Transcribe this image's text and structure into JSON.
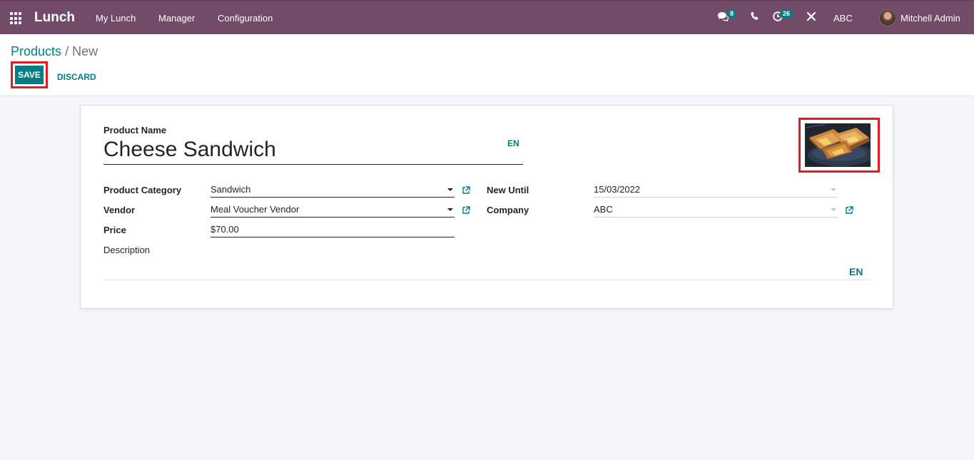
{
  "navbar": {
    "app_name": "Lunch",
    "menus": [
      "My Lunch",
      "Manager",
      "Configuration"
    ],
    "messages_count": "8",
    "activities_count": "26",
    "company": "ABC",
    "user": "Mitchell Admin"
  },
  "breadcrumb": {
    "parent": "Products",
    "separator": "/",
    "current": "New"
  },
  "actions": {
    "save": "SAVE",
    "discard": "DISCARD"
  },
  "form": {
    "product_name_label": "Product Name",
    "product_name_value": "Cheese Sandwich",
    "lang": "EN",
    "category_label": "Product Category",
    "category_value": "Sandwich",
    "vendor_label": "Vendor",
    "vendor_value": "Meal Voucher Vendor",
    "price_label": "Price",
    "price_value": "$70.00",
    "new_until_label": "New Until",
    "new_until_value": "15/03/2022",
    "company_label": "Company",
    "company_value": "ABC",
    "description_label": "Description",
    "description_lang": "EN"
  },
  "colors": {
    "navbar": "#714b67",
    "accent": "#017e84",
    "highlight_border": "#e01b24"
  },
  "icons": [
    "apps-grid-icon",
    "chat-icon",
    "phone-icon",
    "activity-clock-icon",
    "debug-tools-icon",
    "external-link-icon",
    "dropdown-caret-icon"
  ]
}
